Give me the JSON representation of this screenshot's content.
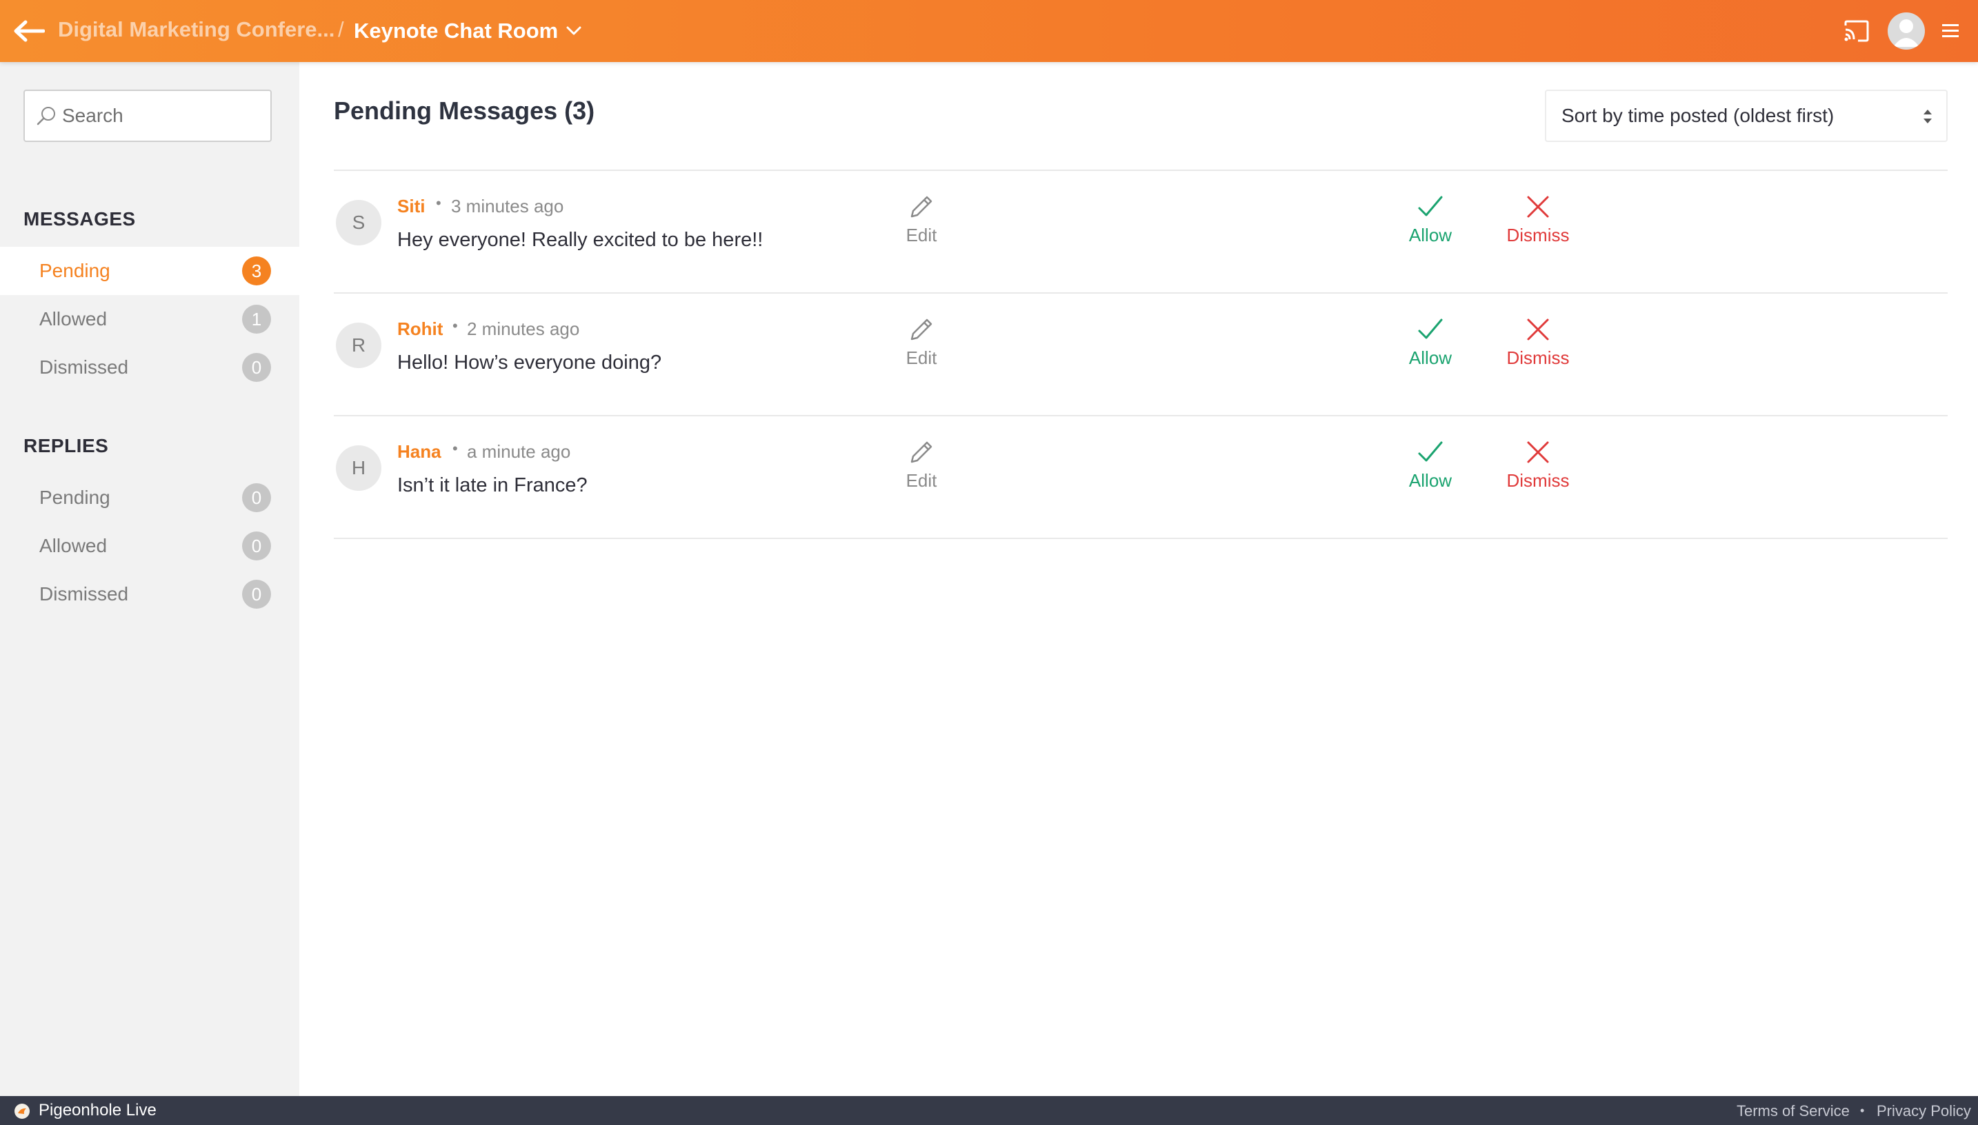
{
  "header": {
    "event_name": "Digital Marketing Confere...",
    "separator": "/",
    "room_name": "Keynote Chat Room",
    "accent_color": "#f47a2a"
  },
  "sidebar": {
    "search_placeholder": "Search",
    "messages_title": "MESSAGES",
    "messages_items": [
      {
        "label": "Pending",
        "count": "3",
        "active": true
      },
      {
        "label": "Allowed",
        "count": "1",
        "active": false
      },
      {
        "label": "Dismissed",
        "count": "0",
        "active": false
      }
    ],
    "replies_title": "REPLIES",
    "replies_items": [
      {
        "label": "Pending",
        "count": "0"
      },
      {
        "label": "Allowed",
        "count": "0"
      },
      {
        "label": "Dismissed",
        "count": "0"
      }
    ]
  },
  "main": {
    "title": "Pending Messages (3)",
    "sort_label": "Sort by time posted (oldest first)",
    "messages": [
      {
        "initial": "S",
        "author": "Siti",
        "time": "3 minutes ago",
        "text": "Hey everyone! Really excited to be here!!"
      },
      {
        "initial": "R",
        "author": "Rohit",
        "time": "2 minutes ago",
        "text": "Hello! How’s everyone doing?"
      },
      {
        "initial": "H",
        "author": "Hana",
        "time": "a minute ago",
        "text": "Isn’t it late in France?"
      }
    ],
    "actions": {
      "edit": "Edit",
      "allow": "Allow",
      "dismiss": "Dismiss"
    },
    "colors": {
      "allow": "#1aa36f",
      "dismiss": "#e03a3a",
      "edit": "#8a8a8a"
    }
  },
  "footer": {
    "brand": "Pigeonhole Live",
    "terms": "Terms of Service",
    "separator": "•",
    "privacy": "Privacy Policy"
  }
}
